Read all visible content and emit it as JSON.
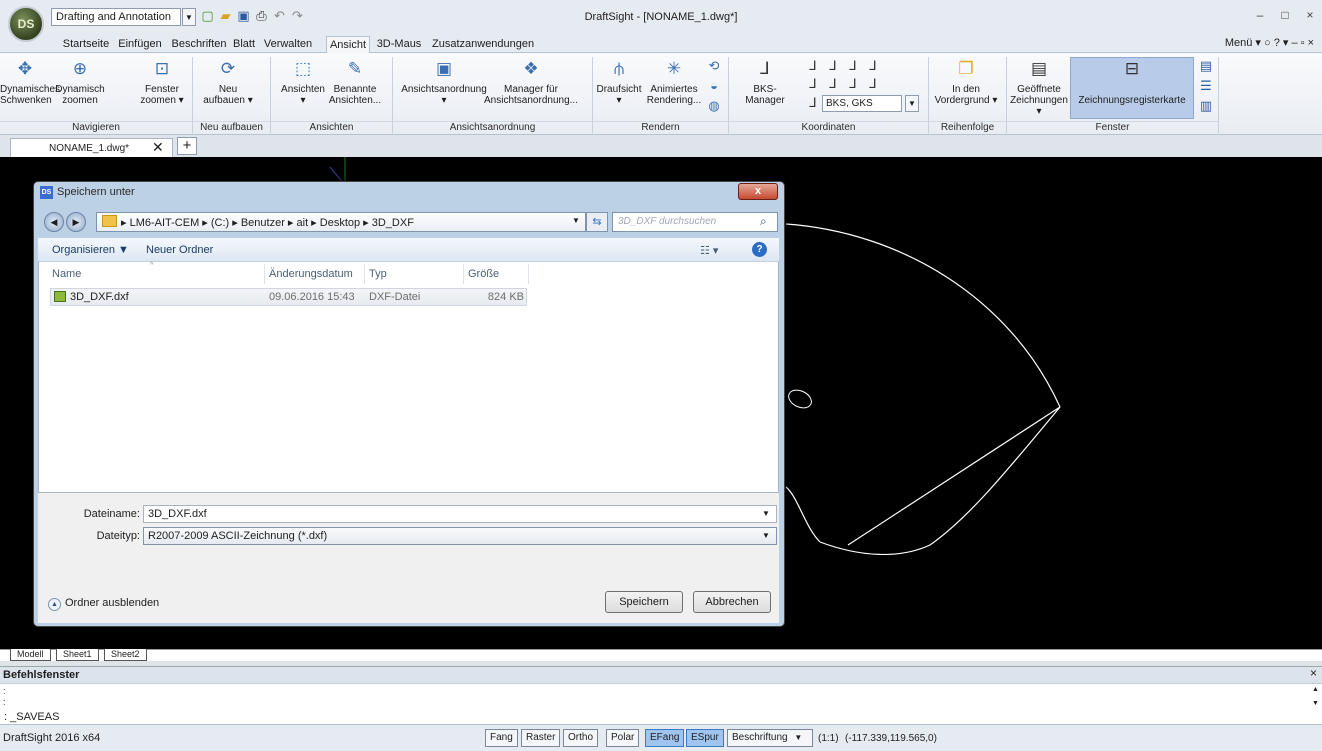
{
  "app": {
    "logo_text": "DS",
    "workspace": "Drafting and Annotation",
    "title": "DraftSight - [NONAME_1.dwg*]",
    "menu_right": "Menü ▾ ○ ? ▾ – ▫ ×",
    "quick_access_icons": [
      "new-icon",
      "open-icon",
      "save-icon",
      "print-icon",
      "undo-icon",
      "redo-icon"
    ]
  },
  "menu_tabs": [
    {
      "label": "Startseite"
    },
    {
      "label": "Einfügen"
    },
    {
      "label": "Beschriften"
    },
    {
      "label": "Blatt"
    },
    {
      "label": "Verwalten"
    },
    {
      "label": "Ansicht"
    },
    {
      "label": "3D-Maus"
    },
    {
      "label": "Zusatzanwendungen"
    }
  ],
  "active_tab": "Ansicht",
  "ribbon": {
    "groups": [
      {
        "label": "Navigieren"
      },
      {
        "label": "Neu aufbauen"
      },
      {
        "label": "Ansichten"
      },
      {
        "label": "Ansichtsanordnung"
      },
      {
        "label": "Rendern"
      },
      {
        "label": "Koordinaten"
      },
      {
        "label": "Reihenfolge"
      },
      {
        "label": "Fenster"
      }
    ],
    "buttons": {
      "pan_l1": "Dynamisches",
      "pan_l2": "Schwenken",
      "zoom_l1": "Dynamisch",
      "zoom_l2": "zoomen",
      "zwin_l1": "Fenster",
      "zwin_l2": "zoomen ▾",
      "rebuild_l1": "Neu",
      "rebuild_l2": "aufbauen ▾",
      "views_l1": "Ansichten",
      "views_l2": "▾",
      "named_l1": "Benannte",
      "named_l2": "Ansichten...",
      "layout_l1": "Ansichtsanordnung",
      "layout_l2": "▾",
      "layoutmgr_l1": "Manager für",
      "layoutmgr_l2": "Ansichtsanordnung...",
      "top_l1": "Draufsicht",
      "top_l2": "▾",
      "anim_l1": "Animiertes",
      "anim_l2": "Rendering...",
      "ucs": "BKS-Manager",
      "front_l1": "In den",
      "front_l2": "Vordergrund ▾",
      "open_l1": "Geöffnete",
      "open_l2": "Zeichnungen ▾",
      "tabs": "Zeichnungsregisterkarte"
    },
    "ucs_select": "BKS, GKS"
  },
  "doc_tab": {
    "label": "NONAME_1.dwg*",
    "close": "✕",
    "add": "+"
  },
  "sheet_tabs": [
    {
      "label": "Modell"
    },
    {
      "label": "Sheet1"
    },
    {
      "label": "Sheet2"
    }
  ],
  "command": {
    "title": "Befehlsfenster",
    "close": "×",
    "lines": [
      ":",
      ":"
    ],
    "input": ": _SAVEAS"
  },
  "status": {
    "app": "DraftSight 2016 x64",
    "toggles": [
      {
        "label": "Fang",
        "on": false
      },
      {
        "label": "Raster",
        "on": false
      },
      {
        "label": "Ortho",
        "on": false
      },
      {
        "label": "Polar",
        "on": false
      },
      {
        "label": "EFang",
        "on": true
      },
      {
        "label": "ESpur",
        "on": true
      }
    ],
    "annotation": "Beschriftung",
    "scale": "(1:1)",
    "coords": "(-117.339,119.565,0)"
  },
  "dialog": {
    "title": "Speichern unter",
    "close": "x",
    "address": "▸ LM6-AIT-CEM ▸ (C:) ▸ Benutzer ▸ ait ▸ Desktop ▸ 3D_DXF",
    "search_placeholder": "3D_DXF durchsuchen",
    "toolbar": {
      "organize": "Organisieren ▼",
      "new_folder": "Neuer Ordner",
      "view_icon": "☷ ▾",
      "help": "?"
    },
    "columns": {
      "name": "Name",
      "date": "Änderungsdatum",
      "type": "Typ",
      "size": "Größe"
    },
    "files": [
      {
        "name": "3D_DXF.dxf",
        "date": "09.06.2016 15:43",
        "type": "DXF-Datei",
        "size": "824 KB"
      }
    ],
    "filename_label": "Dateiname:",
    "filename": "3D_DXF.dxf",
    "filetype_label": "Dateityp:",
    "filetype": "R2007-2009 ASCII-Zeichnung (*.dxf)",
    "hide_folders": "Ordner ausblenden",
    "save": "Speichern",
    "cancel": "Abbrechen"
  },
  "colors": {
    "canvas": "#000000",
    "ribbon_highlight": "#b8cbe8",
    "toggle_on": "#9fc5ee",
    "dialog_frame": "#bcd0e6"
  }
}
